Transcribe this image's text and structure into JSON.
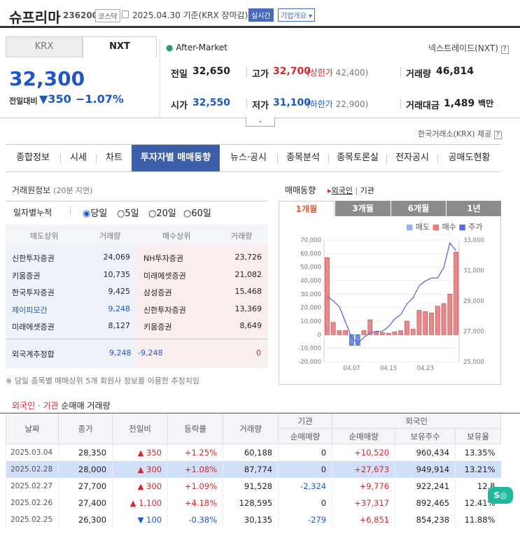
{
  "header": {
    "name": "슈프리마",
    "code": "236200",
    "market": "코스닥",
    "date": "2025.04.30",
    "basis": "기준(KRX 장마감)",
    "realtime": "실시간",
    "company": "기업개요"
  },
  "exch_tabs": [
    "KRX",
    "NXT"
  ],
  "after_market": "After-Market",
  "nxt_link": "넥스트레이드(NXT)",
  "price": {
    "current": "32,300",
    "change_label": "전일대비",
    "change": "350",
    "change_rate": "−1.07%"
  },
  "stats": {
    "prev_label": "전일",
    "prev": "32,650",
    "high_label": "고가",
    "high": "32,700",
    "upper_label": "(상한가",
    "upper": "42,400)",
    "volume_label": "거래량",
    "volume": "46,814",
    "open_label": "시가",
    "open": "32,550",
    "low_label": "저가",
    "low": "31,100",
    "lower_label": "(하한가",
    "lower": "22,900)",
    "amount_label": "거래대금",
    "amount": "1,489",
    "amount_unit": "백만"
  },
  "provider": "한국거래소(KRX) 제공",
  "nav": [
    "종합정보",
    "시세",
    "차트",
    "투자자별 매매동향",
    "뉴스·공시",
    "종목분석",
    "종목토론실",
    "전자공시",
    "공매도현황"
  ],
  "trade_info": {
    "title": "거래원정보",
    "delay": "(20분 지연)",
    "cum_label": "일자별누적",
    "options": [
      "당일",
      "5일",
      "20일",
      "60일"
    ],
    "heads": [
      "매도상위",
      "거래량",
      "매수상위",
      "거래량"
    ],
    "rows": [
      [
        "신한투자증권",
        "24,069",
        "NH투자증권",
        "23,726"
      ],
      [
        "키움증권",
        "10,735",
        "미래에셋증권",
        "21,082"
      ],
      [
        "한국투자증권",
        "9,425",
        "삼성증권",
        "15,468"
      ],
      [
        "제이피모간",
        "9,248",
        "신한투자증권",
        "13,369"
      ],
      [
        "미래에셋증권",
        "8,127",
        "키움증권",
        "8,649"
      ]
    ],
    "foreign_label": "외국계추정합",
    "foreign_sell": "9,248",
    "foreign_net": "-9,248",
    "foreign_buy": "0",
    "footnote": "※ 당일 종목별 매매상위 5개 회원사 정보를 이용한 추정치임"
  },
  "trend": {
    "title": "매매동향",
    "opt1": "외국인",
    "opt2": "기관",
    "periods": [
      "1개월",
      "3개월",
      "6개월",
      "1년"
    ],
    "legend": [
      "매도",
      "매수",
      "주가"
    ]
  },
  "chart_data": {
    "type": "bar",
    "x": [
      "04.01",
      "04.02",
      "04.03",
      "04.04",
      "04.07",
      "04.08",
      "04.09",
      "04.10",
      "04.11",
      "04.14",
      "04.15",
      "04.16",
      "04.17",
      "04.18",
      "04.21",
      "04.22",
      "04.23",
      "04.24",
      "04.25",
      "04.28",
      "04.29",
      "04.30"
    ],
    "xticks": [
      "04.07",
      "04.15",
      "04.23"
    ],
    "y_left_ticks": [
      "70,000",
      "60,000",
      "50,000",
      "40,000",
      "30,000",
      "20,000",
      "10,000",
      "0",
      "-10,000",
      "-20,000"
    ],
    "y_right_ticks": [
      "33,000",
      "31,000",
      "29,000",
      "27,000",
      "25,000"
    ],
    "ylim": [
      -20000,
      70000
    ],
    "y2lim": [
      25000,
      33000
    ],
    "net_buy": [
      57000,
      9000,
      3000,
      3000,
      -8000,
      -8000,
      3000,
      11000,
      2000,
      1500,
      1000,
      2000,
      3000,
      10000,
      4000,
      18000,
      17000,
      16000,
      21000,
      23000,
      30000,
      61000
    ],
    "price": [
      29300,
      29000,
      28600,
      27600,
      26600,
      26200,
      26600,
      26900,
      27000,
      27000,
      27300,
      27800,
      28100,
      28800,
      29200,
      30000,
      30300,
      30500,
      30500,
      31200,
      32800,
      32300
    ]
  },
  "bottom": {
    "title1": "외국인 · 기관",
    "title2": "순매매 거래량",
    "heads": [
      "날짜",
      "종가",
      "전일비",
      "등락률",
      "거래량",
      "기관",
      "외국인",
      "순매매량",
      "순매매량",
      "보유주수",
      "보유율"
    ],
    "rows": [
      {
        "date": "2025.03.04",
        "close": "28,350",
        "dir": "▲",
        "diff": "350",
        "rate": "+1.25%",
        "vol": "60,188",
        "inst": "0",
        "frn": "+10,520",
        "hold": "960,434",
        "ratio": "13.35%"
      },
      {
        "date": "2025.02.28",
        "close": "28,000",
        "dir": "▲",
        "diff": "300",
        "rate": "+1.08%",
        "vol": "87,774",
        "inst": "0",
        "frn": "+27,673",
        "hold": "949,914",
        "ratio": "13.21%"
      },
      {
        "date": "2025.02.27",
        "close": "27,700",
        "dir": "▲",
        "diff": "300",
        "rate": "+1.09%",
        "vol": "91,528",
        "inst": "-2,324",
        "frn": "+9,776",
        "hold": "922,241",
        "ratio": "12.8"
      },
      {
        "date": "2025.02.26",
        "close": "27,400",
        "dir": "▲",
        "diff": "1,100",
        "rate": "+4.18%",
        "vol": "128,595",
        "inst": "0",
        "frn": "+37,317",
        "hold": "892,465",
        "ratio": "12.41%"
      },
      {
        "date": "2025.02.25",
        "close": "26,300",
        "dir": "▼",
        "diff": "100",
        "rate": "-0.38%",
        "vol": "30,135",
        "inst": "-279",
        "frn": "+6,851",
        "hold": "854,238",
        "ratio": "11.88%"
      }
    ]
  }
}
